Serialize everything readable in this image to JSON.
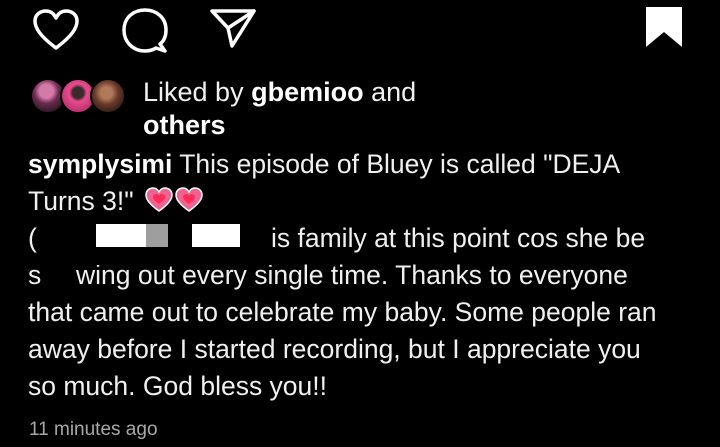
{
  "actions": {
    "like_icon": "heart-outline-icon",
    "comment_icon": "comment-icon",
    "share_icon": "send-icon",
    "save_icon": "bookmark-icon"
  },
  "likes": {
    "prefix": "Liked by ",
    "user": "gbemioo",
    "and": " and",
    "others": "others"
  },
  "caption": {
    "username": "symplysimi",
    "line1": " This episode of Bluey is called \"DEJA",
    "line2": "Turns 3!\"",
    "emoji": "heart-emoji",
    "line3_visible": "is family at this point cos she be",
    "line4_visible_a": "s",
    "line4_visible_b": "wing out every single time. Thanks to everyone",
    "line5": "that came out to celebrate my baby. Some people ran",
    "line6": "away before I started recording, but I appreciate you",
    "line7": "so much. God bless you!!"
  },
  "timestamp": "11 minutes ago",
  "colors": {
    "background": "#000000",
    "text": "#f0f0f0",
    "muted": "#a8a8a8",
    "heart_pink": "#f06292"
  }
}
